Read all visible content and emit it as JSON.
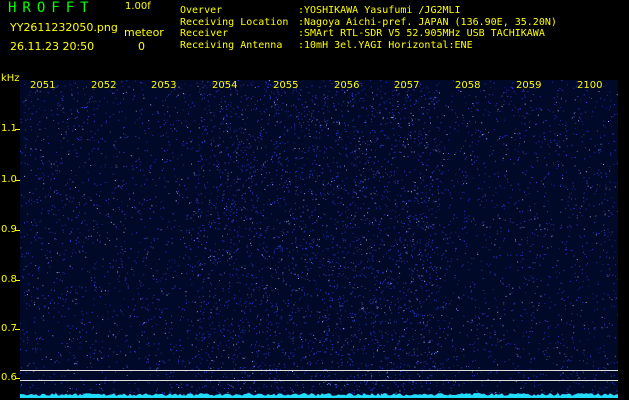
{
  "header": {
    "app_title": "HROFFT",
    "app_version": "1.00f",
    "filename": "YY2611232050.png",
    "datetime": "26.11.23 20:50",
    "meteor_label": "meteor",
    "meteor_count": "0"
  },
  "info": [
    {
      "label": "Overver",
      "value": ":YOSHIKAWA Yasufumi /JG2MLI"
    },
    {
      "label": "Receiving Location",
      "value": ":Nagoya Aichi-pref. JAPAN (136.90E, 35.20N)"
    },
    {
      "label": "Receiver",
      "value": ":SMArt RTL-SDR V5 52.905MHz USB TACHIKAWA"
    },
    {
      "label": "Receiving Antenna",
      "value": ":10mH 3el.YAGI Horizontal:ENE"
    }
  ],
  "spectrogram": {
    "y_unit": "kHz",
    "y_ticks": [
      "1.1",
      "1.0",
      "0.9",
      "0.8",
      "0.7",
      "0.6"
    ],
    "x_ticks": [
      "2051",
      "2052",
      "2053",
      "2054",
      "2055",
      "2056",
      "2057",
      "2058",
      "2059",
      "2100"
    ],
    "colors": {
      "background": "#000a28",
      "noise": "#3344ff",
      "noise_bright": "#aabbff",
      "baseline": "#22ddff",
      "labels": "#ffff00",
      "title": "#00ff00"
    }
  }
}
